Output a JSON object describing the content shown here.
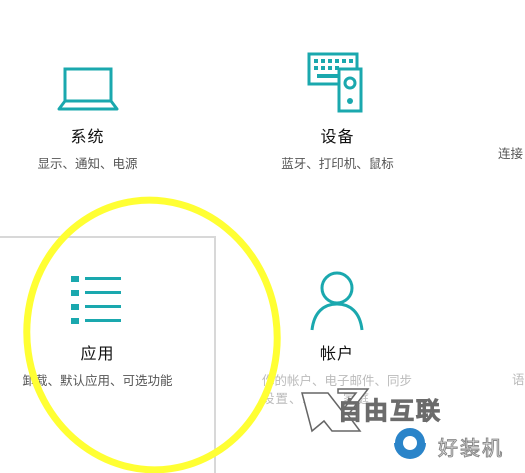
{
  "tiles": {
    "system": {
      "title": "系统",
      "desc": "显示、通知、电源"
    },
    "devices": {
      "title": "设备",
      "desc": "蓝牙、打印机、鼠标"
    },
    "network_partial": {
      "desc": "连接"
    },
    "apps": {
      "title": "应用",
      "desc": "卸载、默认应用、可选功能"
    },
    "accounts": {
      "title": "帐户",
      "desc": "你的帐户、电子邮件、同步",
      "desc2": "设置、工作、家庭"
    },
    "partial_right": {
      "desc": "语"
    }
  },
  "watermark": {
    "brand": "自由互联",
    "site": "好装机"
  },
  "colors": {
    "accent": "#1aa8ae",
    "highlight": "#ffff33",
    "border": "#d8d8d8"
  },
  "icons": {
    "system": "laptop-icon",
    "devices": "keyboard-speaker-icon",
    "apps": "app-list-icon",
    "accounts": "person-icon"
  }
}
